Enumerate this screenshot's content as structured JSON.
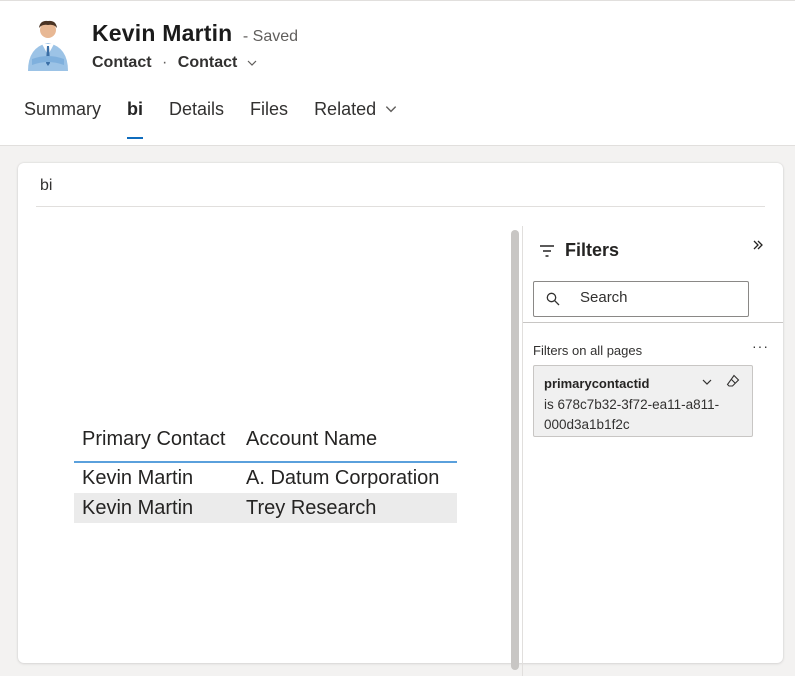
{
  "record": {
    "name": "Kevin Martin",
    "status": "- Saved",
    "entity": "Contact",
    "separator": "·",
    "form": "Contact"
  },
  "tabs": [
    {
      "label": "Summary"
    },
    {
      "label": "bi"
    },
    {
      "label": "Details"
    },
    {
      "label": "Files"
    },
    {
      "label": "Related"
    }
  ],
  "section": {
    "title": "bi"
  },
  "report": {
    "columns": [
      "Primary Contact",
      "Account Name"
    ],
    "rows": [
      [
        "Kevin Martin",
        "A. Datum Corporation"
      ],
      [
        "Kevin Martin",
        "Trey Research"
      ]
    ]
  },
  "filters": {
    "title": "Filters",
    "search_placeholder": "Search",
    "section_label": "Filters on all pages",
    "more": "···",
    "card": {
      "field": "primarycontactid",
      "value": "is 678c7b32-3f72-ea11-a811-000d3a1b1f2c"
    }
  },
  "colors": {
    "accent": "#0f6cbd",
    "header_line": "#5aa0dc"
  }
}
